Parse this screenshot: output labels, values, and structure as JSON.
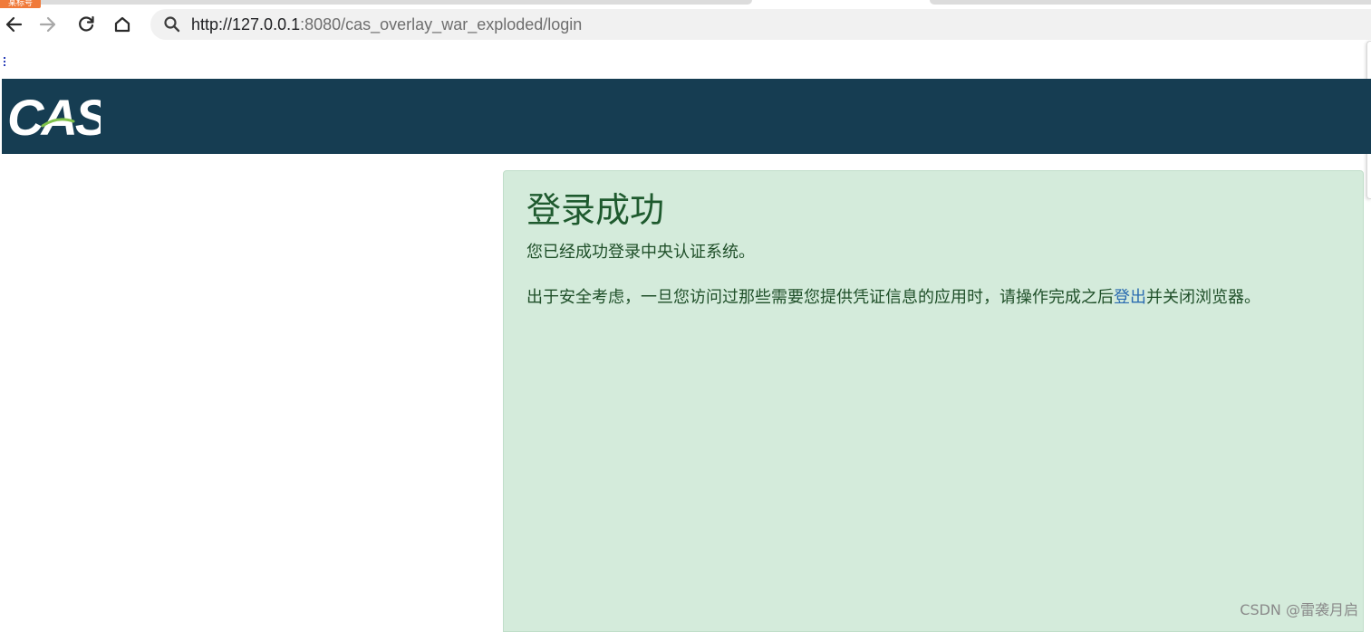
{
  "browser": {
    "tab_badge": "某标号",
    "url_host": "http://127.0.0.1",
    "url_rest": ":8080/cas_overlay_war_exploded/login"
  },
  "header": {
    "logo_text": "CAS",
    "background_color": "#163d52"
  },
  "panel": {
    "title": "登录成功",
    "message": "您已经成功登录中央认证系统。",
    "notice_before": "出于安全考虑，一旦您访问过那些需要您提供凭证信息的应用时，请操作完成之后",
    "logout_link": "登出",
    "notice_after": "并关闭浏览器。",
    "background_color": "#d4ebdb",
    "text_color": "#1f4f29",
    "link_color": "#2a6bb0"
  },
  "watermark": "CSDN @雷袭月启",
  "icons": {
    "back": "arrow-left-icon",
    "forward": "arrow-right-icon",
    "reload": "reload-icon",
    "home": "home-icon",
    "search": "search-icon"
  }
}
